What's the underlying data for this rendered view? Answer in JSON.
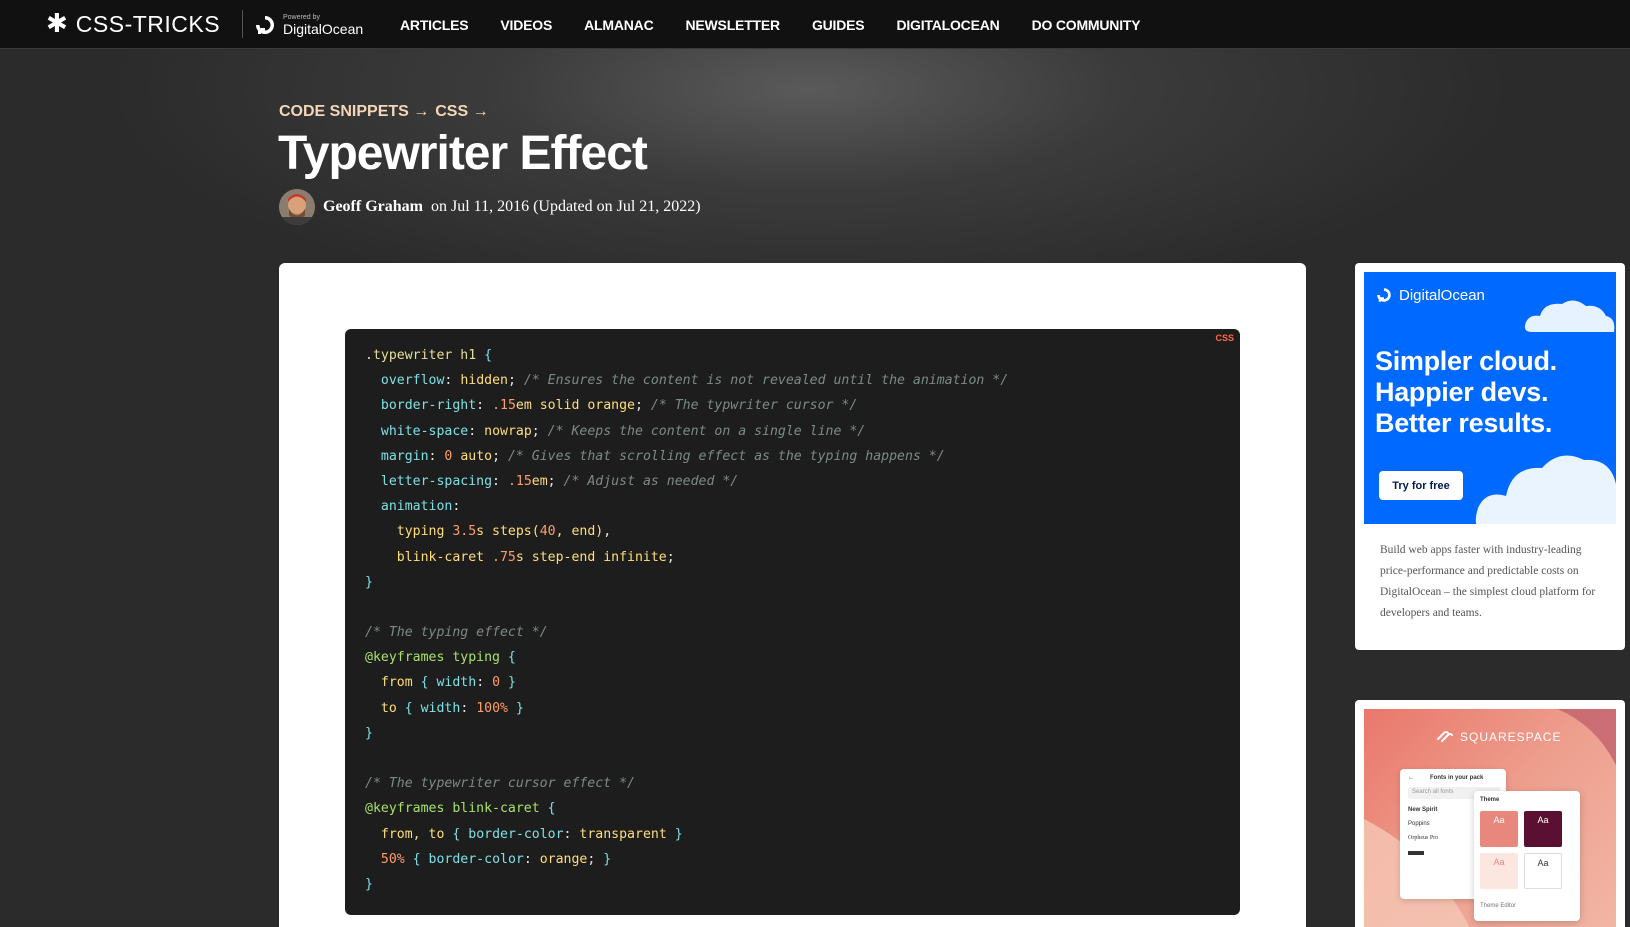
{
  "header": {
    "logo_text": "CSS-TRICKS",
    "powered_by": "Powered by",
    "powered_brand": "DigitalOcean",
    "nav": [
      "ARTICLES",
      "VIDEOS",
      "ALMANAC",
      "NEWSLETTER",
      "GUIDES",
      "DIGITALOCEAN",
      "DO COMMUNITY"
    ]
  },
  "article": {
    "breadcrumb": [
      "CODE SNIPPETS →",
      "CSS →"
    ],
    "title": "Typewriter Effect",
    "author": "Geoff Graham",
    "date_text": "on Jul 11, 2016 (Updated on Jul 21, 2022)"
  },
  "code": {
    "language": "CSS",
    "lines": [
      [
        [
          "sel",
          ".typewriter h1 "
        ],
        [
          "brace",
          "{"
        ]
      ],
      [
        [
          "plain",
          "  "
        ],
        [
          "prop",
          "overflow"
        ],
        [
          "plain",
          ": "
        ],
        [
          "val",
          "hidden"
        ],
        [
          "plain",
          "; "
        ],
        [
          "cmt",
          "/* Ensures the content is not revealed until the animation */"
        ]
      ],
      [
        [
          "plain",
          "  "
        ],
        [
          "prop",
          "border-right"
        ],
        [
          "plain",
          ": "
        ],
        [
          "num",
          ".15"
        ],
        [
          "val",
          "em solid orange"
        ],
        [
          "plain",
          "; "
        ],
        [
          "cmt",
          "/* The typwriter cursor */"
        ]
      ],
      [
        [
          "plain",
          "  "
        ],
        [
          "prop",
          "white-space"
        ],
        [
          "plain",
          ": "
        ],
        [
          "val",
          "nowrap"
        ],
        [
          "plain",
          "; "
        ],
        [
          "cmt",
          "/* Keeps the content on a single line */"
        ]
      ],
      [
        [
          "plain",
          "  "
        ],
        [
          "prop",
          "margin"
        ],
        [
          "plain",
          ": "
        ],
        [
          "num",
          "0"
        ],
        [
          "val",
          " auto"
        ],
        [
          "plain",
          "; "
        ],
        [
          "cmt",
          "/* Gives that scrolling effect as the typing happens */"
        ]
      ],
      [
        [
          "plain",
          "  "
        ],
        [
          "prop",
          "letter-spacing"
        ],
        [
          "plain",
          ": "
        ],
        [
          "num",
          ".15"
        ],
        [
          "val",
          "em"
        ],
        [
          "plain",
          "; "
        ],
        [
          "cmt",
          "/* Adjust as needed */"
        ]
      ],
      [
        [
          "plain",
          "  "
        ],
        [
          "prop",
          "animation"
        ],
        [
          "plain",
          ":"
        ]
      ],
      [
        [
          "plain",
          "    "
        ],
        [
          "val",
          "typing "
        ],
        [
          "num",
          "3.5"
        ],
        [
          "val",
          "s steps("
        ],
        [
          "num",
          "40"
        ],
        [
          "val",
          ", end)"
        ],
        [
          "plain",
          ","
        ]
      ],
      [
        [
          "plain",
          "    "
        ],
        [
          "val",
          "blink-caret "
        ],
        [
          "num",
          ".75"
        ],
        [
          "val",
          "s step-end infinite"
        ],
        [
          "plain",
          ";"
        ]
      ],
      [
        [
          "brace",
          "}"
        ]
      ],
      [
        [
          "plain",
          ""
        ]
      ],
      [
        [
          "cmt",
          "/* The typing effect */"
        ]
      ],
      [
        [
          "at",
          "@keyframes typing "
        ],
        [
          "brace",
          "{"
        ]
      ],
      [
        [
          "plain",
          "  "
        ],
        [
          "val",
          "from "
        ],
        [
          "brace",
          "{ "
        ],
        [
          "prop",
          "width"
        ],
        [
          "plain",
          ": "
        ],
        [
          "num",
          "0"
        ],
        [
          "brace",
          " }"
        ]
      ],
      [
        [
          "plain",
          "  "
        ],
        [
          "val",
          "to "
        ],
        [
          "brace",
          "{ "
        ],
        [
          "prop",
          "width"
        ],
        [
          "plain",
          ": "
        ],
        [
          "num",
          "100%"
        ],
        [
          "brace",
          " }"
        ]
      ],
      [
        [
          "brace",
          "}"
        ]
      ],
      [
        [
          "plain",
          ""
        ]
      ],
      [
        [
          "cmt",
          "/* The typewriter cursor effect */"
        ]
      ],
      [
        [
          "at",
          "@keyframes blink-caret "
        ],
        [
          "brace",
          "{"
        ]
      ],
      [
        [
          "plain",
          "  "
        ],
        [
          "val",
          "from, to "
        ],
        [
          "brace",
          "{ "
        ],
        [
          "prop",
          "border-color"
        ],
        [
          "plain",
          ": "
        ],
        [
          "val",
          "transparent"
        ],
        [
          "brace",
          " }"
        ]
      ],
      [
        [
          "plain",
          "  "
        ],
        [
          "num",
          "50%"
        ],
        [
          "brace",
          " { "
        ],
        [
          "prop",
          "border-color"
        ],
        [
          "plain",
          ": "
        ],
        [
          "val",
          "orange"
        ],
        [
          "plain",
          "; "
        ],
        [
          "brace",
          "}"
        ]
      ],
      [
        [
          "brace",
          "}"
        ]
      ]
    ]
  },
  "sidebar": {
    "ad1": {
      "brand": "DigitalOcean",
      "headline": [
        "Simpler cloud.",
        "Happier devs.",
        "Better results."
      ],
      "cta": "Try for free",
      "copy": "Build web apps faster with industry-leading price-performance and predictable costs on DigitalOcean – the simplest cloud platform for developers and teams."
    },
    "ad2": {
      "brand": "SQUARESPACE",
      "panel_title": "Fonts in your pack",
      "search_placeholder": "Search all fonts",
      "fonts": [
        "New Spirit",
        "Poppins",
        "Orpheus Pro"
      ],
      "theme_label": "Theme",
      "swatch_label": "Aa",
      "footer_label": "Theme Editor"
    }
  },
  "colors": {
    "accent_breadcrumb": "#f4d7b8",
    "do_blue": "#0069ff",
    "code_bg": "#1d1d1d",
    "lang_badge": "#ff6a3d"
  }
}
